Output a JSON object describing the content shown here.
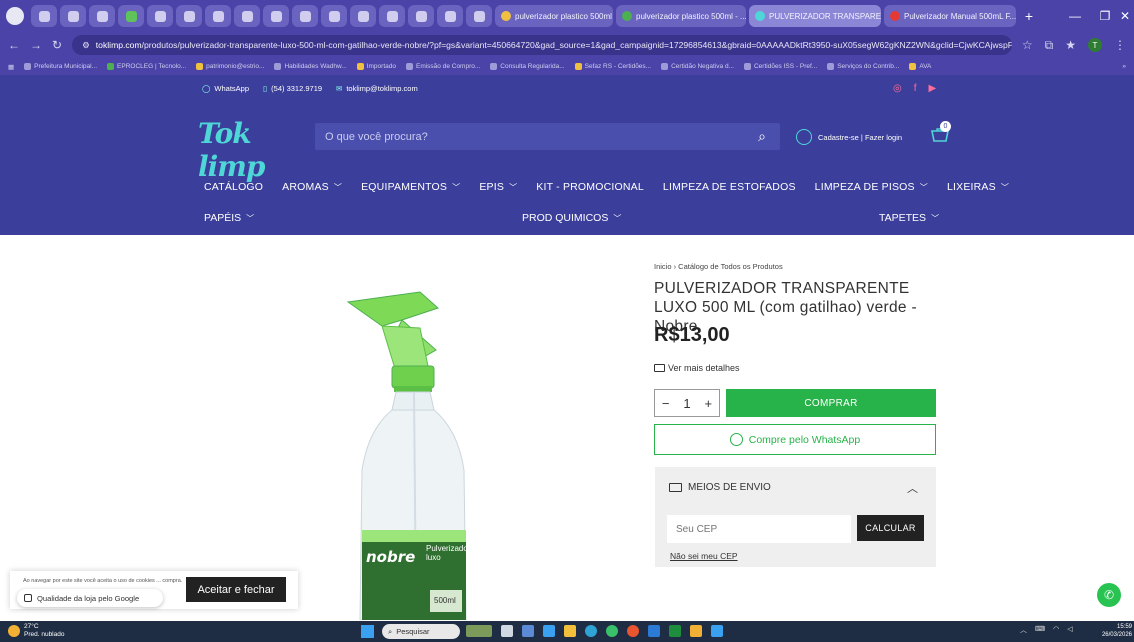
{
  "browser": {
    "tabs": [
      {
        "label": "pulverizador plastico 500ml n..."
      },
      {
        "label": "pulverizador plastico 500ml - ..."
      },
      {
        "label": "PULVERIZADOR TRANSPAREN..."
      },
      {
        "label": "Pulverizador Manual 500mL F..."
      }
    ],
    "url_domain": "toklimp.com",
    "url_path": "/produtos/pulverizador-transparente-luxo-500-ml-com-gatilhao-verde-nobre/?pf=gs&variant=450664720&gad_source=1&gad_campaignid=17296854613&gbraid=0AAAAADktRt3950-suX05segW62gKNZ2WN&gclid=CjwKCAjwspP...",
    "profile_initial": "T",
    "bookmarks": [
      "Prefeitura Municipal...",
      "EPROCLEG | Tecnolo...",
      "patrimonio@estrio...",
      "Habilidades Wadhw...",
      "Importado",
      "Emissão de Compro...",
      "Consulta Regularida...",
      "Sefaz RS - Certidões...",
      "Certidão Negativa d...",
      "Certidões ISS - Pref...",
      "Serviços do Contrib...",
      "AVA"
    ]
  },
  "header": {
    "whatsapp_label": "WhatsApp",
    "phone": "(54) 3312.9719",
    "email": "toklimp@toklimp.com",
    "logo_text": "Tok limp",
    "search_placeholder": "O que você procura?",
    "account_label": "Cadastre-se  |  Fazer login",
    "cart_count": "0",
    "nav_row1": [
      "CATÁLOGO",
      "AROMAS",
      "EQUIPAMENTOS",
      "EPIS",
      "KIT - PROMOCIONAL",
      "LIMPEZA DE ESTOFADOS",
      "LIMPEZA DE PISOS",
      "LIXEIRAS"
    ],
    "nav_row2": [
      "PAPÉIS",
      "PROD QUIMICOS",
      "TAPETES"
    ]
  },
  "product": {
    "breadcrumb": "Inicio  ›  Catálogo de Todos os Produtos",
    "title": "PULVERIZADOR TRANSPARENTE LUXO 500 ML (com gatilhao) verde - Nobre",
    "price": "R$13,00",
    "details_label": "Ver mais detalhes",
    "quantity": "1",
    "buy_label": "COMPRAR",
    "whatsapp_buy_label": "Compre pelo WhatsApp",
    "bottle_brand": "nobre",
    "bottle_label": "Pulverizador luxo",
    "bottle_volume": "500ml"
  },
  "shipping": {
    "title": "MEIOS DE ENVIO",
    "cep_placeholder": "Seu CEP",
    "calc_label": "CALCULAR",
    "no_cep_label": "Não sei meu CEP"
  },
  "cookie": {
    "text": "Ao navegar por este site você aceita o uso de cookies ... compra.",
    "accept_label": "Aceitar e fechar",
    "quality_label": "Qualidade da loja pelo Google"
  },
  "taskbar": {
    "temperature": "27°C",
    "weather_desc": "Pred. nublado",
    "search_label": "Pesquisar",
    "time": "15:59",
    "date": "26/03/2026"
  }
}
